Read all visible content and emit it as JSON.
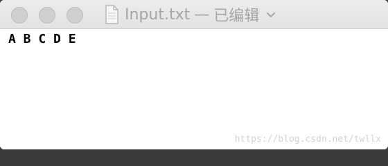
{
  "window": {
    "title": "Input.txt",
    "separator": "—",
    "status": "已编辑",
    "icons": {
      "close": "close-button",
      "minimize": "minimize-button",
      "zoom": "zoom-button",
      "document": "document-icon",
      "chevron": "chevron-down-icon"
    }
  },
  "editor": {
    "content": "A B C D E"
  },
  "watermark": {
    "text": "https://blog.csdn.net/twllx"
  },
  "colors": {
    "title_text": "#a6a6a6",
    "traffic_light_inactive": "#d0d0d0",
    "body_text": "#000000",
    "watermark_text": "#d4d4d4"
  }
}
